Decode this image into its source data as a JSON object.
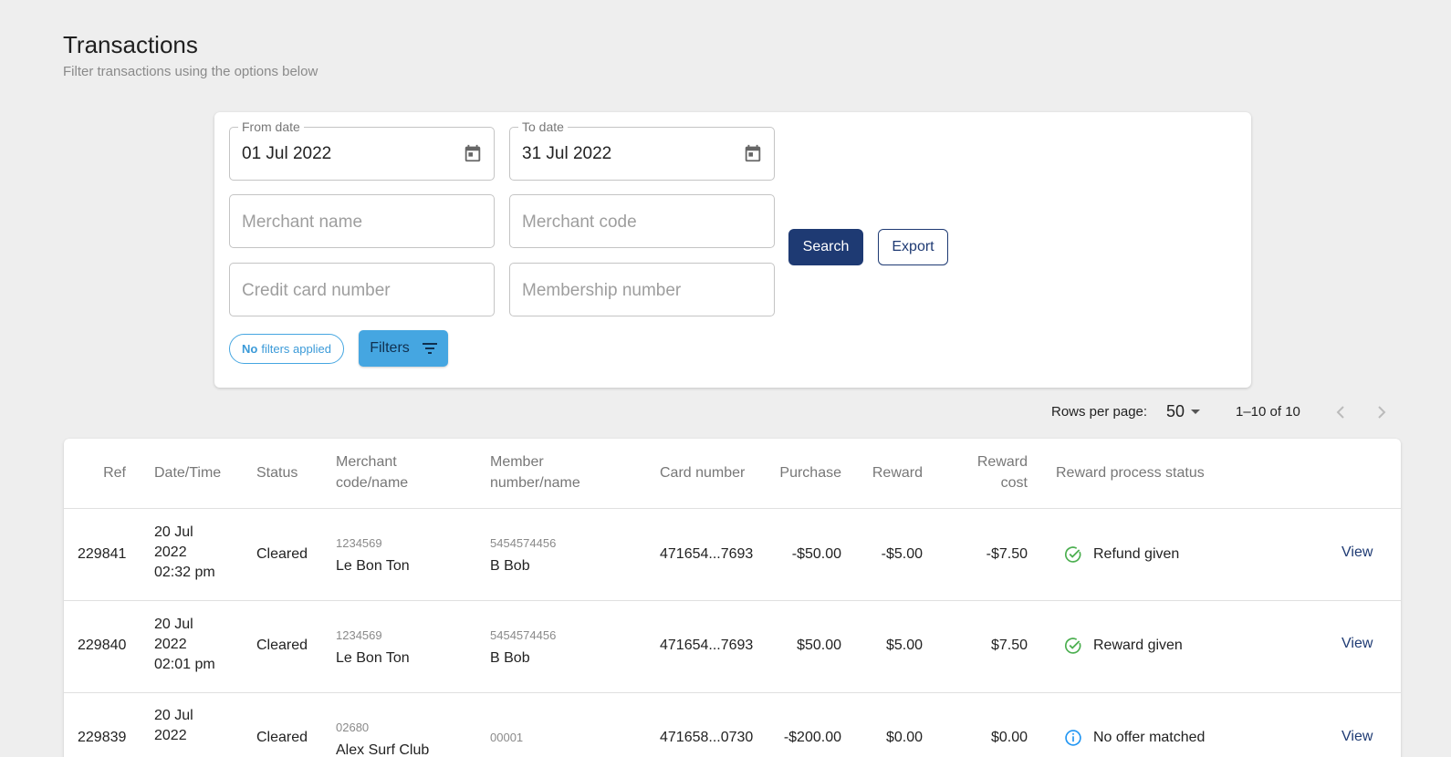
{
  "header": {
    "title": "Transactions",
    "subtitle": "Filter transactions using the options below"
  },
  "filters": {
    "from_date": {
      "label": "From date",
      "value": "01 Jul 2022"
    },
    "to_date": {
      "label": "To date",
      "value": "31 Jul 2022"
    },
    "merchant_name_placeholder": "Merchant name",
    "merchant_code_placeholder": "Merchant code",
    "credit_card_placeholder": "Credit card number",
    "membership_placeholder": "Membership number",
    "search_label": "Search",
    "export_label": "Export",
    "chip_bold": "No",
    "chip_rest": "filters applied",
    "filters_label": "Filters"
  },
  "pagination": {
    "rows_per_page_label": "Rows per page:",
    "rows_per_page_value": "50",
    "range": "1–10 of 10"
  },
  "table": {
    "columns": {
      "ref": "Ref",
      "datetime": "Date/Time",
      "status": "Status",
      "merchant_1": "Merchant",
      "merchant_2": "code/name",
      "member_1": "Member",
      "member_2": "number/name",
      "card": "Card number",
      "purchase": "Purchase",
      "reward": "Reward",
      "reward_cost_1": "Reward",
      "reward_cost_2": "cost",
      "process_status": "Reward process status"
    },
    "rows": [
      {
        "ref": "229841",
        "date_1": "20 Jul",
        "date_2": "2022",
        "date_3": "02:32 pm",
        "status": "Cleared",
        "merchant_code": "1234569",
        "merchant_name": "Le Bon Ton",
        "member_number": "5454574456",
        "member_name": "B Bob",
        "card": "471654...7693",
        "purchase": "-$50.00",
        "reward": "-$5.00",
        "reward_cost": "-$7.50",
        "process_status": "Refund given",
        "process_icon": "check-circle-icon",
        "view": "View"
      },
      {
        "ref": "229840",
        "date_1": "20 Jul",
        "date_2": "2022",
        "date_3": "02:01 pm",
        "status": "Cleared",
        "merchant_code": "1234569",
        "merchant_name": "Le Bon Ton",
        "member_number": "5454574456",
        "member_name": "B Bob",
        "card": "471654...7693",
        "purchase": "$50.00",
        "reward": "$5.00",
        "reward_cost": "$7.50",
        "process_status": "Reward given",
        "process_icon": "check-circle-icon",
        "view": "View"
      },
      {
        "ref": "229839",
        "date_1": "20 Jul",
        "date_2": "2022",
        "date_3": "",
        "status": "Cleared",
        "merchant_code": "02680",
        "merchant_name": "Alex Surf Club",
        "member_number": "00001",
        "member_name": "",
        "card": "471658...0730",
        "purchase": "-$200.00",
        "reward": "$0.00",
        "reward_cost": "$0.00",
        "process_status": "No offer matched",
        "process_icon": "info-circle-icon",
        "view": "View"
      }
    ]
  },
  "colors": {
    "primary": "#1e3a73",
    "accent": "#45a6e1",
    "success": "#4caf50",
    "info": "#2196f3"
  }
}
